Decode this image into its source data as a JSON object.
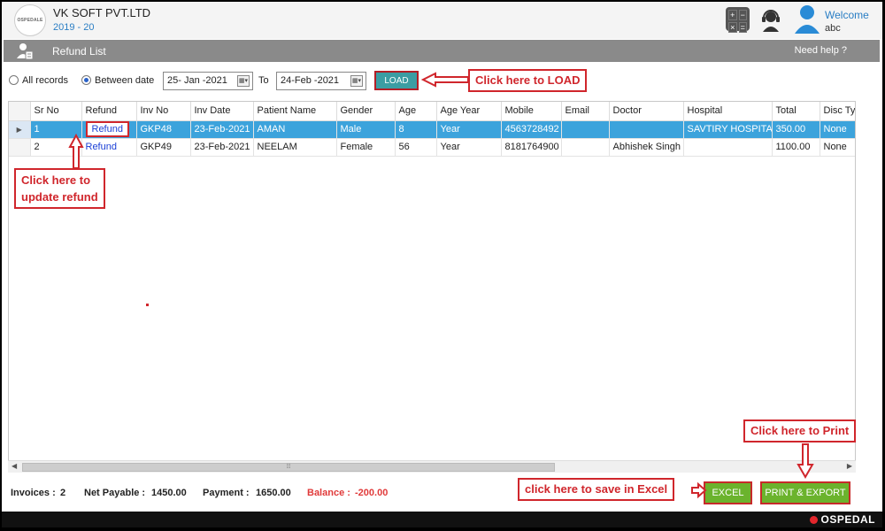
{
  "header": {
    "logo_text": "OSPEDALE",
    "company": "VK SOFT PVT.LTD",
    "year": "2019 - 20",
    "welcome": "Welcome",
    "user": "abc"
  },
  "titlebar": {
    "title": "Refund List",
    "help": "Need help ?"
  },
  "filters": {
    "all_records_label": "All records",
    "all_records_selected": false,
    "between_label": "Between date",
    "between_selected": true,
    "from_date": "25- Jan -2021",
    "to_label": "To",
    "to_date": "24-Feb -2021",
    "load_label": "LOAD"
  },
  "grid": {
    "columns": [
      "Sr No",
      "Refund",
      "Inv No",
      "Inv Date",
      "Patient Name",
      "Gender",
      "Age",
      "Age Year",
      "Mobile",
      "Email",
      "Doctor",
      "Hospital",
      "Total",
      "Disc Typ"
    ],
    "rows": [
      {
        "sr": "1",
        "refund": "Refund",
        "inv": "GKP48",
        "date": "23-Feb-2021",
        "patient": "AMAN",
        "gender": "Male",
        "age": "8",
        "age_year": "Year",
        "mobile": "4563728492",
        "email": "",
        "doctor": "",
        "hospital": "SAVTIRY HOSPITAL",
        "total": "350.00",
        "disc": "None"
      },
      {
        "sr": "2",
        "refund": "Refund",
        "inv": "GKP49",
        "date": "23-Feb-2021",
        "patient": "NEELAM",
        "gender": "Female",
        "age": "56",
        "age_year": "Year",
        "mobile": "8181764900",
        "email": "",
        "doctor": "Abhishek Singh",
        "hospital": "",
        "total": "1100.00",
        "disc": "None"
      }
    ]
  },
  "footer": {
    "invoices_label": "Invoices :",
    "invoices": "2",
    "net_label": "Net Payable :",
    "net": "1450.00",
    "payment_label": "Payment :",
    "payment": "1650.00",
    "balance_label": "Balance :",
    "balance": "-200.00",
    "excel_label": "EXCEL",
    "print_label": "PRINT & EXPORT"
  },
  "annotations": {
    "load": "Click here to LOAD",
    "refund_line1": "Click here to",
    "refund_line2": "update refund",
    "print": "Click here to Print",
    "excel": "click here to save in Excel"
  },
  "brand": "OSPEDAL",
  "colors": {
    "selected_row": "#3ca3dc",
    "load_button": "#3b9da3",
    "green_button": "#6bb32d",
    "annotation_red": "#d0262c",
    "title_bar": "#8a8a8a"
  }
}
